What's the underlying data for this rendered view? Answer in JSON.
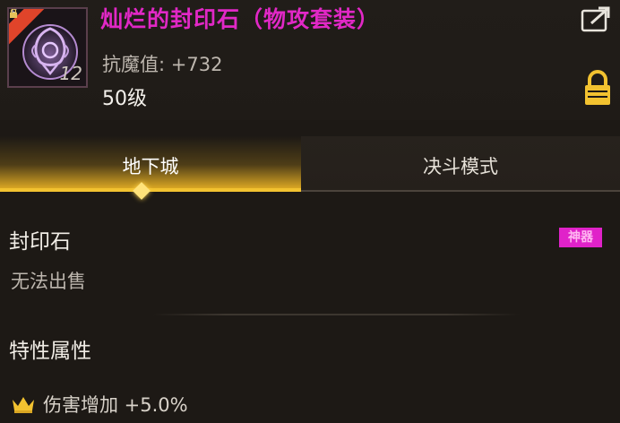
{
  "item": {
    "name": "灿烂的封印石（物攻套装）",
    "slot_number": "5",
    "level_badge": "12",
    "stat": "抗魔值: +732",
    "level": "50级",
    "name_color": "#e128c6"
  },
  "tabs": [
    {
      "label": "地下城",
      "active": true
    },
    {
      "label": "决斗模式",
      "active": false
    }
  ],
  "section_seal": {
    "title": "封印石",
    "tag": "神器",
    "sell_text": "无法出售"
  },
  "section_traits": {
    "title": "特性属性",
    "attributes": [
      {
        "icon": "crown-icon",
        "text": "伤害增加 +5.0%"
      }
    ]
  },
  "icons": {
    "share": "share-icon",
    "lock": "lock-icon",
    "accent": "#f2c230"
  }
}
